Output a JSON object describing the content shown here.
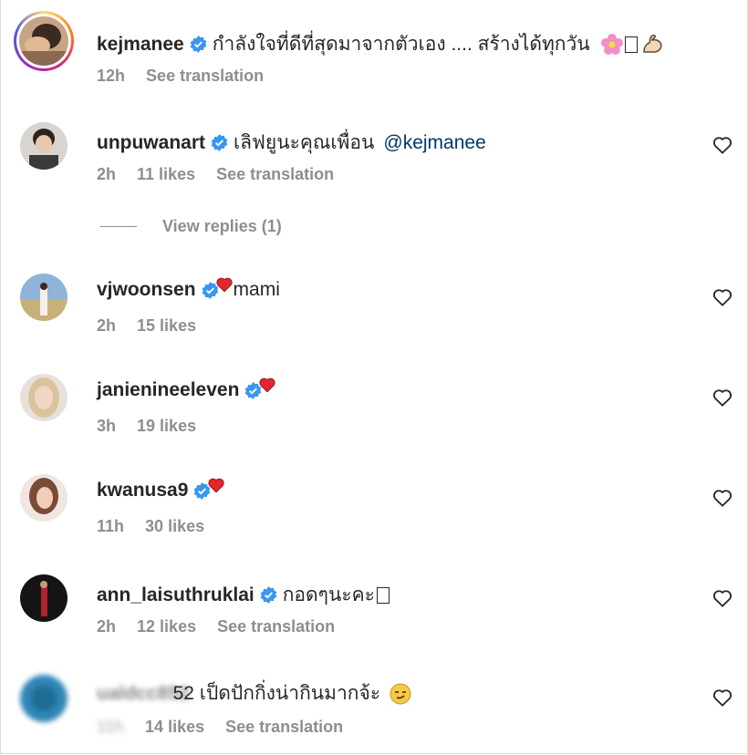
{
  "comments": [
    {
      "username": "kejmanee",
      "text": "กำลังใจที่ดีที่สุดมาจากตัวเอง .... สร้างได้ทุกวัน",
      "time": "12h",
      "likes": "",
      "translation": "See translation"
    },
    {
      "username": "unpuwanart",
      "text": "เลิฟยูนะคุณเพื่อน",
      "mention": "@kejmanee",
      "time": "2h",
      "likes": "11 likes",
      "translation": "See translation"
    },
    {
      "username": "vjwoonsen",
      "text": "mami",
      "time": "2h",
      "likes": "15 likes"
    },
    {
      "username": "janienineeleven",
      "text": "",
      "time": "3h",
      "likes": "19 likes"
    },
    {
      "username": "kwanusa9",
      "text": "",
      "time": "11h",
      "likes": "30 likes"
    },
    {
      "username": "ann_laisuthruklai",
      "text": "กอดๆนะคะ",
      "time": "2h",
      "likes": "12 likes",
      "translation": "See translation"
    },
    {
      "username": "ualdcc852",
      "text": "52 เป็ดปักกิ่งน่ากินมากจ้ะ",
      "time": "11h",
      "likes": "14 likes",
      "translation": "See translation"
    }
  ],
  "view_replies": "View replies (1)",
  "colors": {
    "verified": "#3897f0",
    "mention": "#00376b",
    "meta": "#8e8e8e",
    "heart_red": "#e3262f"
  }
}
